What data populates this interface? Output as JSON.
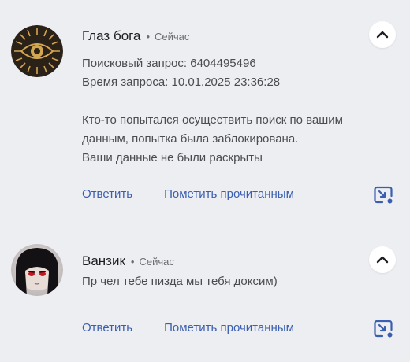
{
  "colors": {
    "background": "#eceef1",
    "action_link": "#3b5fb0",
    "title": "#1d1e21",
    "body": "#4a4c51",
    "button_bg": "#ffffff"
  },
  "notifications": [
    {
      "avatar_icon": "eye-of-providence-icon",
      "app_name": "Глаз бога",
      "separator": "•",
      "time": "Сейчас",
      "lines": [
        "Поисковый запрос: 6404495496",
        "Время запроса: 10.01.2025 23:36:28",
        "",
        "Кто-то попытался осуществить поиск по вашим",
        "данным, попытка была заблокирована.",
        "Ваши данные не были раскрыты"
      ],
      "reply_label": "Ответить",
      "mark_read_label": "Пометить прочитанным"
    },
    {
      "avatar_icon": "user-avatar-icon",
      "app_name": "Ванзик",
      "separator": "•",
      "time": "Сейчас",
      "lines": [
        "Пр чел тебе пизда мы тебя доксим)"
      ],
      "reply_label": "Ответить",
      "mark_read_label": "Пометить прочитанным"
    }
  ]
}
